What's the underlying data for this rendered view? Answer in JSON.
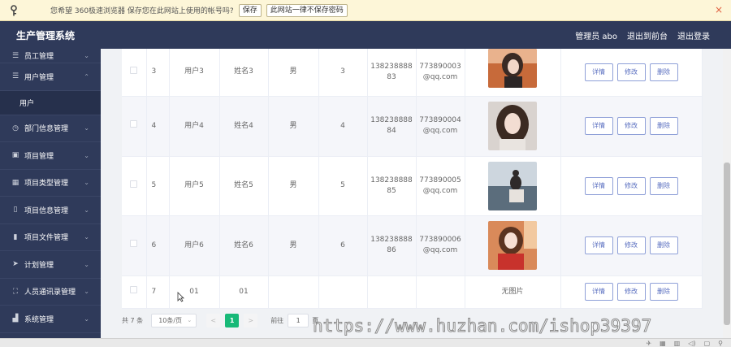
{
  "password_bar": {
    "message": "您希望 360极速浏览器 保存您在此网站上使用的帐号吗?",
    "save_label": "保存",
    "never_label": "此网站一律不保存密码",
    "close_glyph": "×"
  },
  "header": {
    "title": "生产管理系统",
    "admin_label": "管理员 abo",
    "back_front_label": "退出到前台",
    "logout_label": "退出登录"
  },
  "sidebar": {
    "items": [
      {
        "label": "员工管理",
        "icon": "list-icon"
      },
      {
        "label": "用户管理",
        "icon": "list-icon",
        "sub": [
          "用户"
        ]
      },
      {
        "label": "部门信息管理",
        "icon": "clock-icon"
      },
      {
        "label": "项目管理",
        "icon": "image-icon"
      },
      {
        "label": "项目类型管理",
        "icon": "grid-icon"
      },
      {
        "label": "项目信息管理",
        "icon": "phone-icon"
      },
      {
        "label": "项目文件管理",
        "icon": "bar-chart-icon"
      },
      {
        "label": "计划管理",
        "icon": "send-icon"
      },
      {
        "label": "人员通讯录管理",
        "icon": "fullscreen-icon"
      },
      {
        "label": "系统管理",
        "icon": "chart-icon"
      }
    ]
  },
  "table": {
    "rows": [
      {
        "id": "3",
        "account": "用户3",
        "name": "姓名3",
        "gender": "男",
        "age": "3",
        "phone": "13823888883",
        "email": "773890003@qq.com",
        "has_image": true
      },
      {
        "id": "4",
        "account": "用户4",
        "name": "姓名4",
        "gender": "男",
        "age": "4",
        "phone": "13823888884",
        "email": "773890004@qq.com",
        "has_image": true
      },
      {
        "id": "5",
        "account": "用户5",
        "name": "姓名5",
        "gender": "男",
        "age": "5",
        "phone": "13823888885",
        "email": "773890005@qq.com",
        "has_image": true
      },
      {
        "id": "6",
        "account": "用户6",
        "name": "姓名6",
        "gender": "男",
        "age": "6",
        "phone": "13823888886",
        "email": "773890006@qq.com",
        "has_image": true
      },
      {
        "id": "7",
        "account": "01",
        "name": "01",
        "gender": "",
        "age": "",
        "phone": "",
        "email": "",
        "has_image": false,
        "no_image_text": "无图片"
      }
    ],
    "actions": {
      "detail": "详情",
      "edit": "修改",
      "delete": "删除"
    }
  },
  "pager": {
    "total": "共 7 条",
    "page_size": "10条/页",
    "prev": "<",
    "current": "1",
    "next": ">",
    "goto_label": "前往",
    "goto_value": "1",
    "page_suffix": "页"
  },
  "watermark": "https://www.huzhan.com/ishop39397",
  "colors": {
    "header_bg": "#2f3a5a",
    "accent_green": "#17b978",
    "button_border": "#8fa0d8"
  }
}
